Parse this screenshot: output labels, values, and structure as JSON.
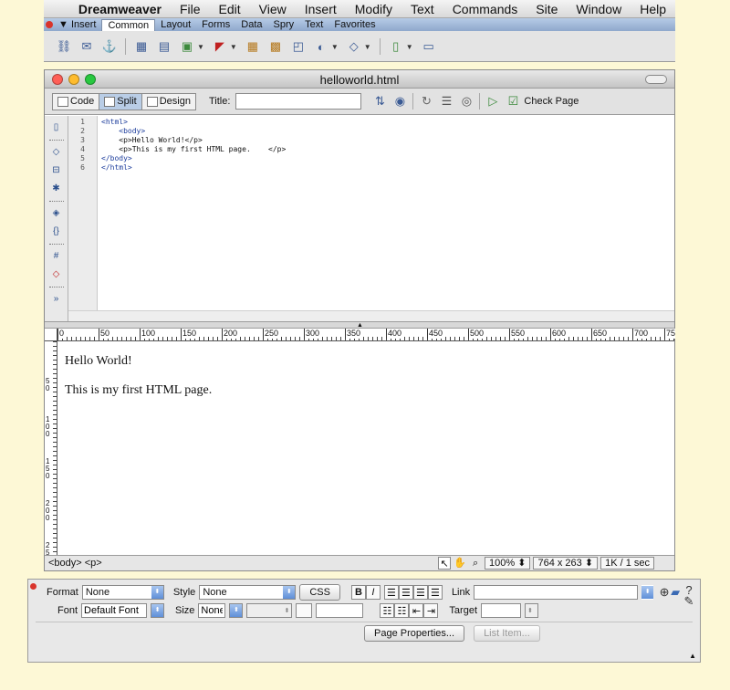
{
  "menubar": {
    "app": "Dreamweaver",
    "items": [
      "File",
      "Edit",
      "View",
      "Insert",
      "Modify",
      "Text",
      "Commands",
      "Site",
      "Window",
      "Help"
    ]
  },
  "insert_panel": {
    "title": "▼ Insert",
    "tabs": [
      "Common",
      "Layout",
      "Forms",
      "Data",
      "Spry",
      "Text",
      "Favorites"
    ],
    "active_tab": "Common",
    "icons": [
      "hyperlink-icon",
      "email-link-icon",
      "named-anchor-icon",
      "table-icon",
      "div-icon",
      "image-icon",
      "media-icon",
      "date-icon",
      "comment-icon",
      "head-icon",
      "script-icon",
      "template-icon",
      "tag-chooser-icon"
    ]
  },
  "document": {
    "filename": "helloworld.html",
    "views": [
      "Code",
      "Split",
      "Design"
    ],
    "active_view": "Split",
    "title_label": "Title:",
    "title_value": "",
    "check_page": "Check Page",
    "code_lines": [
      {
        "num": "1",
        "text": "<html>"
      },
      {
        "num": "2",
        "text": "    <body>"
      },
      {
        "num": "3",
        "text": "    <p>Hello World!</p>"
      },
      {
        "num": "4",
        "text": "    <p>This is my first HTML page.    </p>"
      },
      {
        "num": "5",
        "text": "</body>"
      },
      {
        "num": "6",
        "text": "</html>"
      }
    ],
    "ruler_h": [
      "0",
      "50",
      "100",
      "150",
      "200",
      "250",
      "300",
      "350",
      "400",
      "450",
      "500",
      "550",
      "600",
      "650",
      "700",
      "75"
    ],
    "ruler_v": [
      "5 0",
      "1 0 0",
      "1 5 0",
      "2 0 0",
      "2 5"
    ],
    "design_paragraphs": [
      "Hello World!",
      "This is my first HTML page."
    ],
    "status": {
      "tag_selector": "<body> <p>",
      "zoom": "100%",
      "window_size": "764 x 263",
      "download": "1K / 1 sec"
    }
  },
  "properties": {
    "format_label": "Format",
    "format_value": "None",
    "style_label": "Style",
    "style_value": "None",
    "css_button": "CSS",
    "bold": "B",
    "italic": "I",
    "link_label": "Link",
    "link_value": "",
    "font_label": "Font",
    "font_value": "Default Font",
    "size_label": "Size",
    "size_value": "None",
    "target_label": "Target",
    "target_value": "",
    "page_properties": "Page Properties...",
    "list_item": "List Item..."
  },
  "colors": {
    "desktop": "#fdf8d6",
    "close": "#ff5f57",
    "minimize": "#febc2e",
    "zoom": "#28c840",
    "code_tag": "#1c3c9c"
  }
}
